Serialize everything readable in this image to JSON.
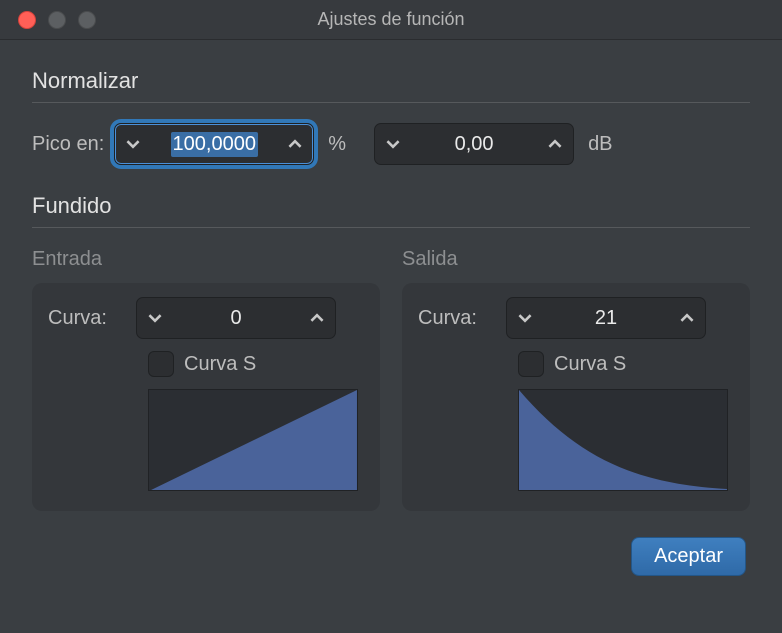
{
  "window": {
    "title": "Ajustes de función"
  },
  "normalize": {
    "header": "Normalizar",
    "peak_label": "Pico en:",
    "percent_value": "100,0000",
    "percent_unit": "%",
    "db_value": "0,00",
    "db_unit": "dB"
  },
  "fade": {
    "header": "Fundido",
    "in": {
      "title": "Entrada",
      "curve_label": "Curva:",
      "curve_value": "0",
      "scurve_label": "Curva S",
      "scurve_checked": false
    },
    "out": {
      "title": "Salida",
      "curve_label": "Curva:",
      "curve_value": "21",
      "scurve_label": "Curva S",
      "scurve_checked": false
    }
  },
  "buttons": {
    "accept": "Aceptar"
  }
}
